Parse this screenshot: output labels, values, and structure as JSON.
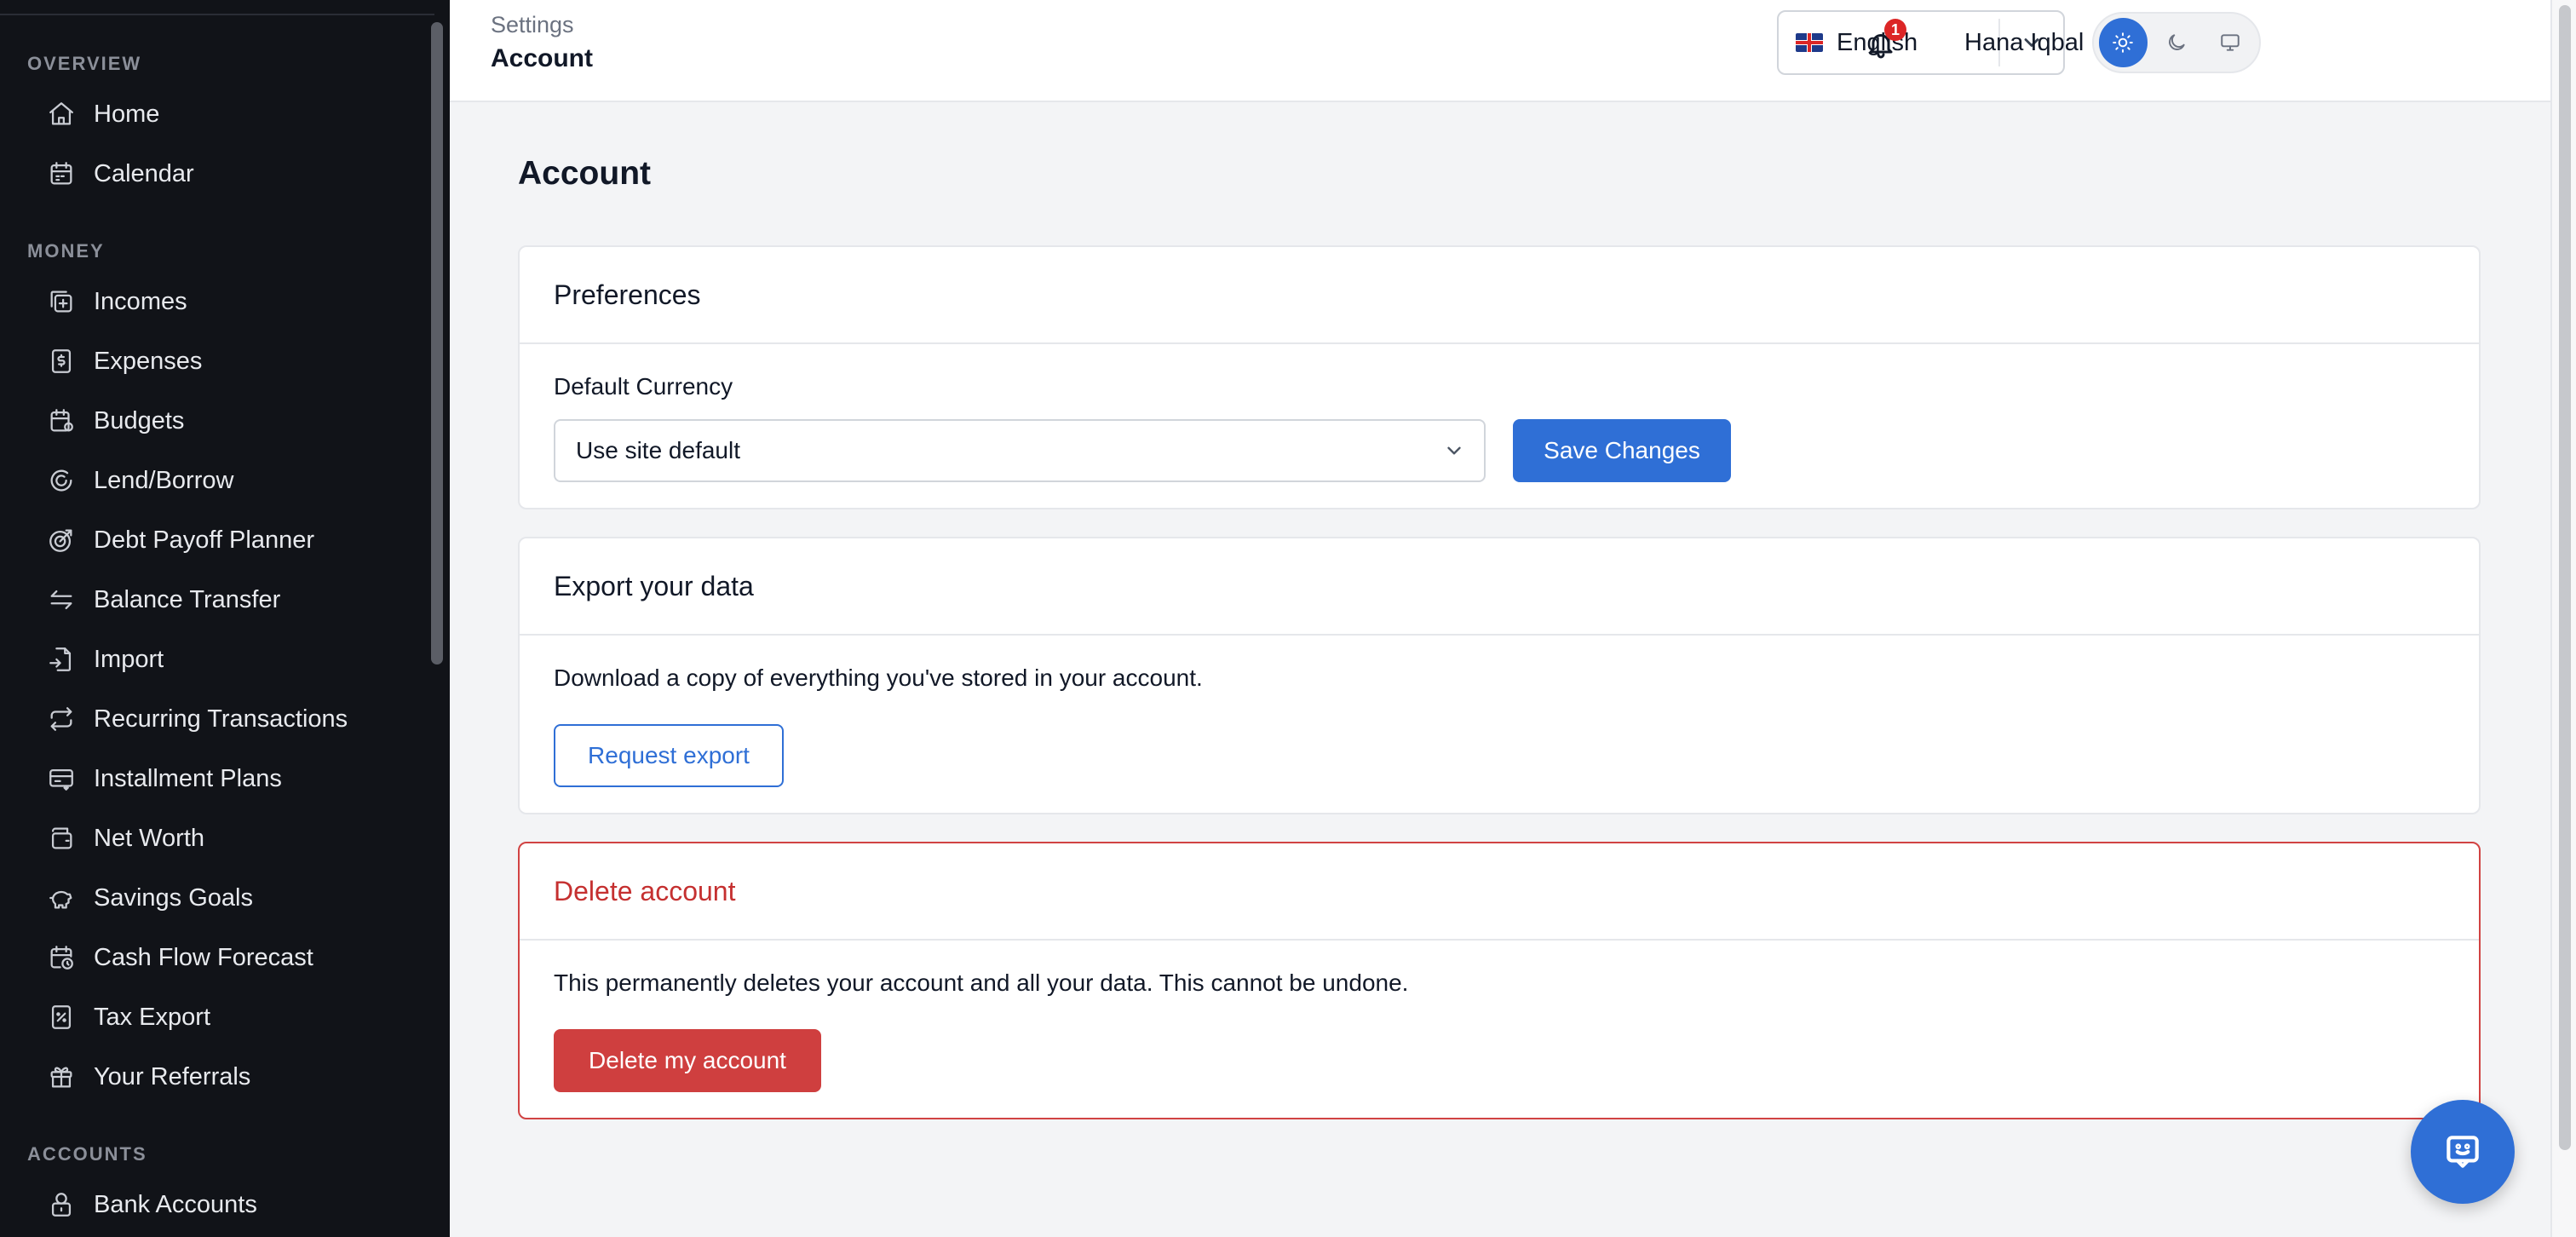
{
  "sidebar": {
    "sections": [
      {
        "label": "OVERVIEW",
        "items": [
          {
            "label": "Home",
            "icon": "home-icon"
          },
          {
            "label": "Calendar",
            "icon": "calendar-icon"
          }
        ]
      },
      {
        "label": "MONEY",
        "items": [
          {
            "label": "Incomes",
            "icon": "income-icon"
          },
          {
            "label": "Expenses",
            "icon": "expense-icon"
          },
          {
            "label": "Budgets",
            "icon": "budget-icon"
          },
          {
            "label": "Lend/Borrow",
            "icon": "lend-borrow-icon"
          },
          {
            "label": "Debt Payoff Planner",
            "icon": "target-icon"
          },
          {
            "label": "Balance Transfer",
            "icon": "transfer-icon"
          },
          {
            "label": "Import",
            "icon": "import-icon"
          },
          {
            "label": "Recurring Transactions",
            "icon": "repeat-icon"
          },
          {
            "label": "Installment Plans",
            "icon": "credit-card-icon"
          },
          {
            "label": "Net Worth",
            "icon": "wallet-icon"
          },
          {
            "label": "Savings Goals",
            "icon": "piggy-bank-icon"
          },
          {
            "label": "Cash Flow Forecast",
            "icon": "calendar-clock-icon"
          },
          {
            "label": "Tax Export",
            "icon": "receipt-icon"
          },
          {
            "label": "Your Referrals",
            "icon": "gift-icon"
          }
        ]
      },
      {
        "label": "ACCOUNTS",
        "items": [
          {
            "label": "Bank Accounts",
            "icon": "bank-lock-icon"
          }
        ]
      }
    ]
  },
  "header": {
    "breadcrumb_parent": "Settings",
    "breadcrumb_current": "Account",
    "language": {
      "value": "English",
      "flag": "uk-flag-icon"
    },
    "theme": {
      "options": [
        "light",
        "dark",
        "system"
      ],
      "active": "light"
    },
    "notifications": {
      "count": "1"
    },
    "user_name": "Hana Iqbal"
  },
  "main": {
    "title": "Account",
    "preferences": {
      "heading": "Preferences",
      "field_label": "Default Currency",
      "currency_value": "Use site default",
      "save_label": "Save Changes"
    },
    "export": {
      "heading": "Export your data",
      "description": "Download a copy of everything you've stored in your account.",
      "button_label": "Request export"
    },
    "delete": {
      "heading": "Delete account",
      "description": "This permanently deletes your account and all your data. This cannot be undone.",
      "button_label": "Delete my account"
    }
  },
  "colors": {
    "sidebar_bg": "#111318",
    "primary": "#2f6fd6",
    "danger": "#cf3f3f",
    "page_bg": "#f3f4f6"
  }
}
